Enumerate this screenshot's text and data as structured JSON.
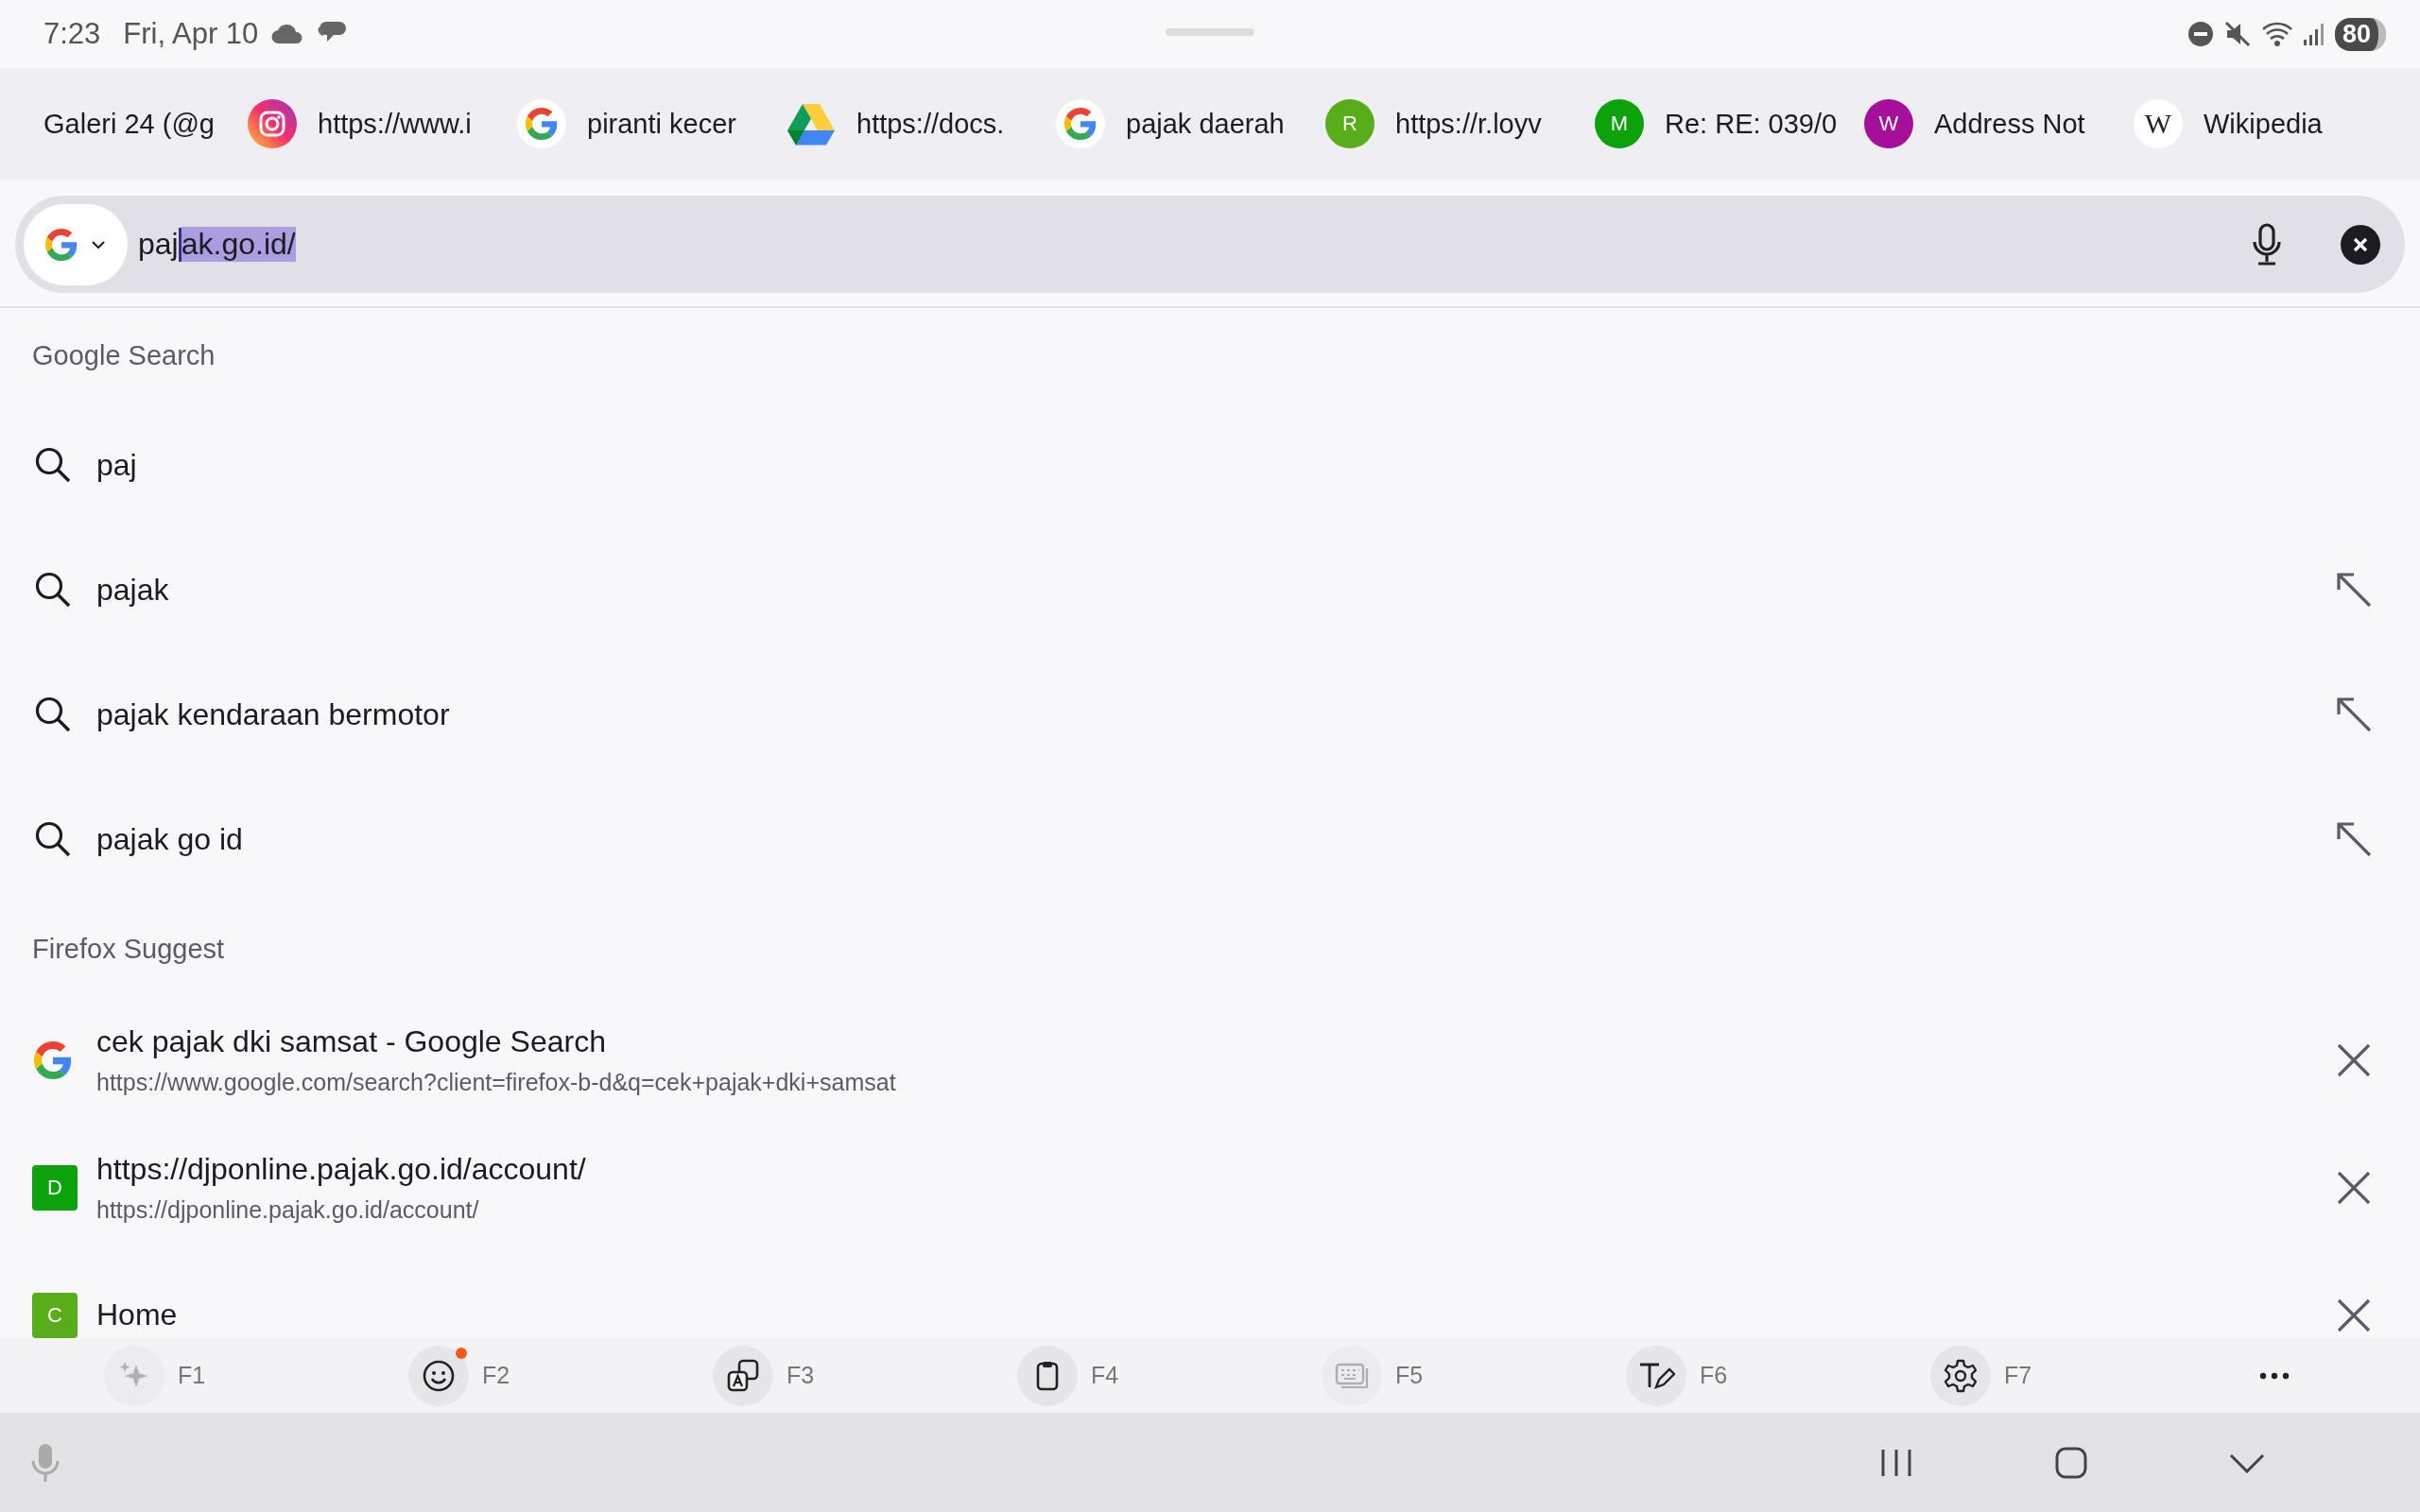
{
  "status_bar": {
    "time": "7:23",
    "date": "Fri, Apr 10",
    "battery": "80"
  },
  "top_sites": [
    {
      "title": "Galeri 24 (@g",
      "kind": "none"
    },
    {
      "title": "https://www.i",
      "kind": "camera"
    },
    {
      "title": "piranti kecer",
      "kind": "google"
    },
    {
      "title": "https://docs.",
      "kind": "triangle"
    },
    {
      "title": "pajak daerah",
      "kind": "google"
    },
    {
      "title": "https://r.loyv",
      "kind": "letter",
      "letter": "R",
      "color": "#5aad1a"
    },
    {
      "title": "Re: RE: 039/0",
      "kind": "letter",
      "letter": "M",
      "color": "#0ca20c"
    },
    {
      "title": "Address Not",
      "kind": "letter",
      "letter": "W",
      "color": "#a50f9a"
    },
    {
      "title": "Wikipedia",
      "kind": "serif",
      "letter": "W"
    }
  ],
  "url_bar": {
    "typed": "paj",
    "autocomplete": "ak.go.id/"
  },
  "sections": [
    {
      "header": "Google Search",
      "items": [
        {
          "kind": "search",
          "title": "paj",
          "fillable": false
        },
        {
          "kind": "search",
          "title": "pajak",
          "fillable": true
        },
        {
          "kind": "search",
          "title": "pajak kendaraan bermotor",
          "fillable": true
        },
        {
          "kind": "search",
          "title": "pajak go id",
          "fillable": true
        }
      ]
    },
    {
      "header": "Firefox Suggest",
      "items": [
        {
          "kind": "google",
          "title": "cek pajak dki samsat - Google Search",
          "url": "https://www.google.com/search?client=firefox-b-d&q=cek+pajak+dki+samsat",
          "removable": true
        },
        {
          "kind": "letter",
          "letter": "D",
          "color": "#0ca20c",
          "title": "https://djponline.pajak.go.id/account/",
          "url": "https://djponline.pajak.go.id/account/",
          "removable": true
        },
        {
          "kind": "letter",
          "letter": "C",
          "color": "#5aad1a",
          "title": "Home",
          "removable": true
        }
      ]
    }
  ],
  "keyboard_toolbar": [
    {
      "label": "F1",
      "kind": "sparkle",
      "disabled": true,
      "badge": false
    },
    {
      "label": "F2",
      "kind": "emoji",
      "disabled": false,
      "badge": true
    },
    {
      "label": "F3",
      "kind": "translate",
      "disabled": false,
      "badge": false
    },
    {
      "label": "F4",
      "kind": "clipboard",
      "disabled": false,
      "badge": false
    },
    {
      "label": "F5",
      "kind": "keyboard",
      "disabled": true,
      "badge": false
    },
    {
      "label": "F6",
      "kind": "handwriting",
      "disabled": false,
      "badge": false
    },
    {
      "label": "F7",
      "kind": "settings",
      "disabled": false,
      "badge": false
    }
  ]
}
